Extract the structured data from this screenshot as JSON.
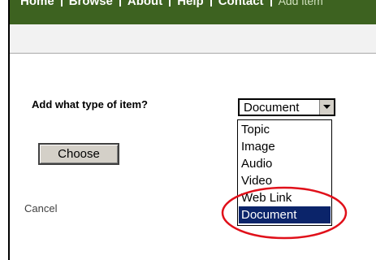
{
  "nav": {
    "items": [
      "Home",
      "Browse",
      "About",
      "Help",
      "Contact"
    ],
    "current": "Add item"
  },
  "form": {
    "question": "Add what type of item?",
    "choose_label": "Choose",
    "cancel_label": "Cancel",
    "select": {
      "value": "Document",
      "options": [
        "Topic",
        "Image",
        "Audio",
        "Video",
        "Web Link",
        "Document"
      ],
      "highlighted": "Document"
    }
  },
  "colors": {
    "nav_bg": "#3d6220",
    "selection_bg": "#0b246a",
    "annotation_circle": "#e0101a"
  }
}
